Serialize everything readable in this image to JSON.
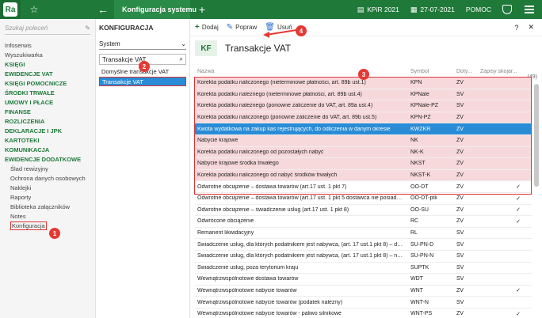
{
  "topbar": {
    "logo": "Ra",
    "tab_title": "Konfiguracja systemu",
    "app_name": "KPiR 2021",
    "date": "27-07-2021",
    "help": "POMOC"
  },
  "sidebar": {
    "search_placeholder": "Szukaj poleceń",
    "items": [
      {
        "label": "Infoserwis",
        "style": "normal"
      },
      {
        "label": "Wyszukiwarka",
        "style": "normal"
      },
      {
        "label": "KSIĘGI",
        "style": "bold"
      },
      {
        "label": "EWIDENCJE VAT",
        "style": "bold"
      },
      {
        "label": "KSIĘGI POMOCNICZE",
        "style": "bold"
      },
      {
        "label": "ŚRODKI TRWAŁE",
        "style": "bold"
      },
      {
        "label": "UMOWY I PŁACE",
        "style": "bold"
      },
      {
        "label": "FINANSE",
        "style": "bold"
      },
      {
        "label": "ROZLICZENIA",
        "style": "bold"
      },
      {
        "label": "DEKLARACJE I JPK",
        "style": "bold"
      },
      {
        "label": "KARTOTEKI",
        "style": "bold"
      },
      {
        "label": "KOMUNIKACJA",
        "style": "bold"
      },
      {
        "label": "EWIDENCJE DODATKOWE",
        "style": "bold"
      },
      {
        "label": "Ślad rewizyjny",
        "style": "sub"
      },
      {
        "label": "Ochrona danych osobowych",
        "style": "sub"
      },
      {
        "label": "Naklejki",
        "style": "sub"
      },
      {
        "label": "Raporty",
        "style": "sub"
      },
      {
        "label": "Biblioteka załączników",
        "style": "sub"
      },
      {
        "label": "Notes",
        "style": "sub"
      },
      {
        "label": "Konfiguracja",
        "style": "selected"
      }
    ]
  },
  "middle": {
    "title": "KONFIGURACJA",
    "select_value": "System",
    "search_value": "Transakcje VAT",
    "items": [
      {
        "label": "Domyślne transakcje VAT",
        "selected": false
      },
      {
        "label": "Transakcje VAT",
        "selected": true
      }
    ]
  },
  "toolbar": {
    "add": "Dodaj",
    "edit": "Popraw",
    "delete": "Usuń",
    "help": "?",
    "close": "✕"
  },
  "main": {
    "badge": "KF",
    "title": "Transakcje VAT",
    "count": "(49)",
    "columns": [
      "Nazwa",
      "Symbol",
      "Doty...",
      "Zapisy skojar..."
    ],
    "rows": [
      {
        "name": "Korekta podatku naliczonego (nieterminowe płatności, art. 89b ust.1)",
        "symbol": "KPN",
        "dot": "ZV",
        "zap": "",
        "state": "hl"
      },
      {
        "name": "Korekta podatku należnego (nieterminowe płatności, art. 89b ust.4)",
        "symbol": "KPNale",
        "dot": "SV",
        "zap": "",
        "state": "hl"
      },
      {
        "name": "Korekta podatku należnego (ponowne zaliczenie do VAT, art. 89a ust.4)",
        "symbol": "KPNale-PZ",
        "dot": "SV",
        "zap": "",
        "state": "hl"
      },
      {
        "name": "Korekta podatku naliczonego (ponowne zaliczenie do VAT, art. 89b ust.5)",
        "symbol": "KPN-PZ",
        "dot": "ZV",
        "zap": "",
        "state": "hl"
      },
      {
        "name": "Kwota wydatkowa na zakup kas rejestrujących, do odliczenia w danym okresie",
        "symbol": "KWZKR",
        "dot": "ZV",
        "zap": "",
        "state": "sel"
      },
      {
        "name": "Nabycie krajowe",
        "symbol": "NK",
        "dot": "ZV",
        "zap": "",
        "state": "hl"
      },
      {
        "name": "Korekta podatku naliczonego od pozostałych nabyć",
        "symbol": "NK-K",
        "dot": "ZV",
        "zap": "",
        "state": "hl"
      },
      {
        "name": "Nabycie krajowe środka trwałego",
        "symbol": "NKST",
        "dot": "ZV",
        "zap": "",
        "state": "hl"
      },
      {
        "name": "Korekta podatku naliczonego od nabyć środków trwałych",
        "symbol": "NKST-K",
        "dot": "ZV",
        "zap": "",
        "state": "hl"
      },
      {
        "name": "Odwrotne obciążenie – dostawa towarów (art.17 ust. 1 pkt 7)",
        "symbol": "OO-DT",
        "dot": "ZV",
        "zap": "✓",
        "state": ""
      },
      {
        "name": "Odwrotne obciążenie – dostawa towarów (art.17 ust. 1 pkt 5 dostawca nie posiad…",
        "symbol": "OO-DT-ptk",
        "dot": "ZV",
        "zap": "✓",
        "state": ""
      },
      {
        "name": "Odwrotne obciążenie – świadczenie usług (art.17 ust. 1 pkt 8)",
        "symbol": "OO-SU",
        "dot": "ZV",
        "zap": "✓",
        "state": ""
      },
      {
        "name": "Odwrócone obciążenie",
        "symbol": "RC",
        "dot": "ZV",
        "zap": "✓",
        "state": ""
      },
      {
        "name": "Remanent likwidacyjny",
        "symbol": "RL",
        "dot": "SV",
        "zap": "",
        "state": ""
      },
      {
        "name": "Świadczenie usług, dla których podatnikiem jest nabywca, (art. 17 ust.1 pkt 8) – d…",
        "symbol": "SU-PN-D",
        "dot": "SV",
        "zap": "",
        "state": ""
      },
      {
        "name": "Świadczenie usług, dla których podatnikiem jest nabywca, (art. 17 ust.1 pkt 8) – n…",
        "symbol": "SU-PN-N",
        "dot": "SV",
        "zap": "",
        "state": ""
      },
      {
        "name": "Świadczenie usług, poza terytorium kraju",
        "symbol": "SUPTK",
        "dot": "SV",
        "zap": "",
        "state": ""
      },
      {
        "name": "Wewnątrzwspólnotowe dostawa towarów",
        "symbol": "WDT",
        "dot": "SV",
        "zap": "",
        "state": ""
      },
      {
        "name": "Wewnątrzwspólnotowe nabycie towarów",
        "symbol": "WNT",
        "dot": "ZV",
        "zap": "✓",
        "state": ""
      },
      {
        "name": "Wewnątrzwspólnotowe nabycie towarów (podatek należny)",
        "symbol": "WNT-N",
        "dot": "SV",
        "zap": "",
        "state": ""
      },
      {
        "name": "Wewnątrzwspólnotowe nabycie towarów - paliwo silnikowe",
        "symbol": "WNT-PS",
        "dot": "ZV",
        "zap": "✓",
        "state": ""
      }
    ]
  },
  "callouts": [
    "1",
    "2",
    "3",
    "4"
  ],
  "colors": {
    "brand": "#1f7a3a",
    "select": "#2a8cd6",
    "highlight": "#f7d9dc",
    "callout": "#e53935"
  }
}
